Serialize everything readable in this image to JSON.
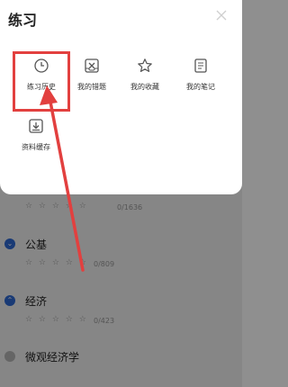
{
  "sheet": {
    "title": "练习",
    "items": [
      {
        "label": "练习历史",
        "icon": "clock-icon"
      },
      {
        "label": "我的错题",
        "icon": "wrong-questions-icon"
      },
      {
        "label": "我的收藏",
        "icon": "star-icon"
      },
      {
        "label": "我的笔记",
        "icon": "note-icon"
      },
      {
        "label": "资料缓存",
        "icon": "download-icon"
      }
    ]
  },
  "background_list": [
    {
      "title": "",
      "stars": "☆ ☆ ☆ ☆ ☆",
      "sub": "0/1636"
    },
    {
      "title": "公基",
      "stars": "☆ ☆ ☆ ☆ ☆",
      "sub": "0/809"
    },
    {
      "title": "经济",
      "stars": "☆ ☆ ☆ ☆ ☆",
      "sub": "0/423"
    },
    {
      "title": "微观经济学",
      "stars": "",
      "sub": ""
    }
  ],
  "colors": {
    "highlight": "#e2403f",
    "accent": "#2f6bd6"
  }
}
